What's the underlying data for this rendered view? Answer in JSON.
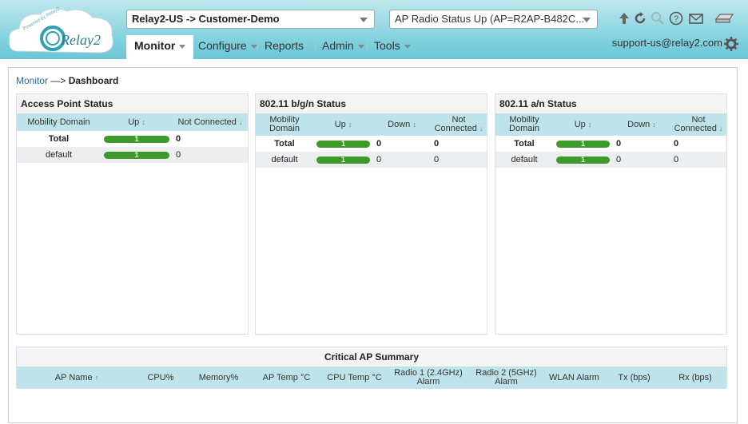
{
  "header": {
    "customer_select": "Relay2-US -> Customer-Demo",
    "radio_select": "AP Radio Status Up (AP=R2AP-B482C...",
    "user": "support-us@relay2.com",
    "logo_text": "Relay2",
    "logo_tagline": "Powered by Relay2"
  },
  "nav": {
    "monitor": "Monitor",
    "configure": "Configure",
    "reports": "Reports",
    "admin": "Admin",
    "tools": "Tools"
  },
  "breadcrumb": {
    "link": "Monitor",
    "sep": " —> ",
    "current": "Dashboard"
  },
  "ap_status": {
    "title": "Access Point Status",
    "cols": [
      "Mobility Domain",
      "Up",
      "Not Connected"
    ],
    "rows": [
      {
        "name": "Total",
        "up": "1",
        "nc": "0"
      },
      {
        "name": "default",
        "up": "1",
        "nc": "0"
      }
    ]
  },
  "bgn_status": {
    "title": "802.11 b/g/n Status",
    "cols": [
      "Mobility Domain",
      "Up",
      "Down",
      "Not Connected"
    ],
    "rows": [
      {
        "name": "Total",
        "up": "1",
        "down": "0",
        "nc": "0"
      },
      {
        "name": "default",
        "up": "1",
        "down": "0",
        "nc": "0"
      }
    ]
  },
  "an_status": {
    "title": "802.11 a/n Status",
    "cols": [
      "Mobility Domain",
      "Up",
      "Down",
      "Not Connected"
    ],
    "rows": [
      {
        "name": "Total",
        "up": "1",
        "down": "0",
        "nc": "0"
      },
      {
        "name": "default",
        "up": "1",
        "down": "0",
        "nc": "0"
      }
    ]
  },
  "critical": {
    "title": "Critical AP Summary",
    "cols": [
      "AP Name",
      "CPU%",
      "Memory%",
      "AP Temp °C",
      "CPU Temp °C",
      "Radio 1 (2.4GHz) Alarm",
      "Radio 2 (5GHz) Alarm",
      "WLAN Alarm",
      "Tx (bps)",
      "Rx (bps)"
    ]
  },
  "icons": [
    "upload-icon",
    "refresh-icon",
    "search-icon",
    "help-icon",
    "mail-icon",
    "router-icon",
    "gear-icon"
  ],
  "colors": {
    "header": "#7fd0dd",
    "table_header": "#bfe3ea",
    "bar": "#3e9a2a",
    "link": "#2a6aa8"
  }
}
